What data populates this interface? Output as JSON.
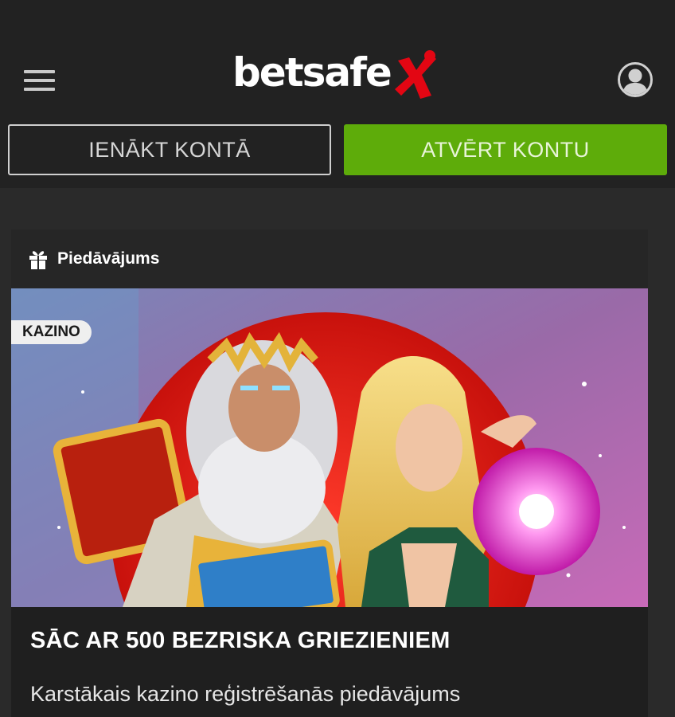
{
  "header": {
    "logo_text": "betsafe",
    "brand_color": "#e30613",
    "menu_icon": "hamburger-icon",
    "profile_icon": "user-icon"
  },
  "auth": {
    "login_label": "IENĀKT KONTĀ",
    "register_label": "ATVĒRT KONTU",
    "register_color": "#5eac0a"
  },
  "offer": {
    "section_label": "Piedāvājums",
    "section_icon": "gift-icon",
    "badge": "KAZINO",
    "title": "SĀC AR 500 BEZRISKA GRIEZIENIEM",
    "description": "Karstākais kazino reģistrēšanās piedāvājums",
    "image_description": "Zeus and blonde sorceress slot game artwork"
  }
}
